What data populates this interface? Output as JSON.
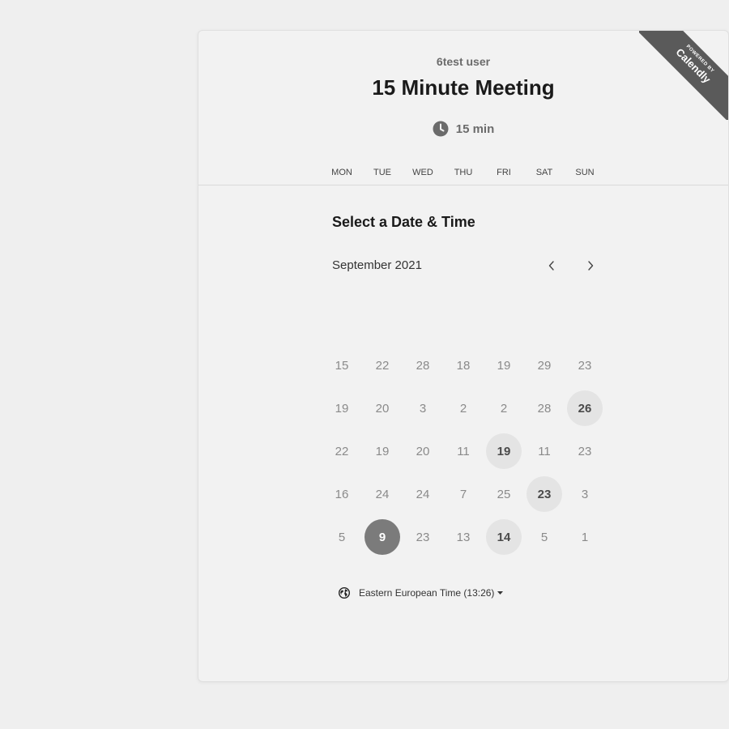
{
  "header": {
    "host_name": "6test user",
    "event_title": "15 Minute Meeting",
    "duration": "15 min",
    "duration_icon": "clock-icon"
  },
  "ribbon": {
    "powered_label": "POWERED BY",
    "brand_label": "Calendly"
  },
  "scheduler": {
    "section_title": "Select a Date & Time",
    "month_label": "September 2021",
    "prev_icon": "chevron-left-icon",
    "next_icon": "chevron-right-icon",
    "weekdays": [
      "MON",
      "TUE",
      "WED",
      "THU",
      "FRI",
      "SAT",
      "SUN"
    ],
    "weeks": [
      [
        {
          "label": "15",
          "state": "disabled"
        },
        {
          "label": "22",
          "state": "disabled"
        },
        {
          "label": "28",
          "state": "disabled"
        },
        {
          "label": "18",
          "state": "disabled"
        },
        {
          "label": "19",
          "state": "disabled"
        },
        {
          "label": "29",
          "state": "disabled"
        },
        {
          "label": "23",
          "state": "disabled"
        }
      ],
      [
        {
          "label": "19",
          "state": "disabled"
        },
        {
          "label": "20",
          "state": "disabled"
        },
        {
          "label": "3",
          "state": "disabled"
        },
        {
          "label": "2",
          "state": "disabled"
        },
        {
          "label": "2",
          "state": "disabled"
        },
        {
          "label": "28",
          "state": "disabled"
        },
        {
          "label": "26",
          "state": "available"
        }
      ],
      [
        {
          "label": "22",
          "state": "disabled"
        },
        {
          "label": "19",
          "state": "disabled"
        },
        {
          "label": "20",
          "state": "disabled"
        },
        {
          "label": "11",
          "state": "disabled"
        },
        {
          "label": "19",
          "state": "available"
        },
        {
          "label": "11",
          "state": "disabled"
        },
        {
          "label": "23",
          "state": "disabled"
        }
      ],
      [
        {
          "label": "16",
          "state": "disabled"
        },
        {
          "label": "24",
          "state": "disabled"
        },
        {
          "label": "24",
          "state": "disabled"
        },
        {
          "label": "7",
          "state": "disabled"
        },
        {
          "label": "25",
          "state": "disabled"
        },
        {
          "label": "23",
          "state": "available"
        },
        {
          "label": "3",
          "state": "disabled"
        }
      ],
      [
        {
          "label": "5",
          "state": "disabled"
        },
        {
          "label": "9",
          "state": "selected"
        },
        {
          "label": "23",
          "state": "disabled"
        },
        {
          "label": "13",
          "state": "disabled"
        },
        {
          "label": "14",
          "state": "available"
        },
        {
          "label": "5",
          "state": "disabled"
        },
        {
          "label": "1",
          "state": "disabled"
        }
      ]
    ],
    "timezone_label": "Eastern European Time (13:26)",
    "timezone_icon": "globe-icon"
  },
  "colors": {
    "page_background": "#efefef",
    "card_background": "#f2f2f2",
    "available_day_bg": "#e4e4e4",
    "selected_day_bg": "#7b7b7b",
    "ribbon_bg": "#5a5a5a"
  }
}
